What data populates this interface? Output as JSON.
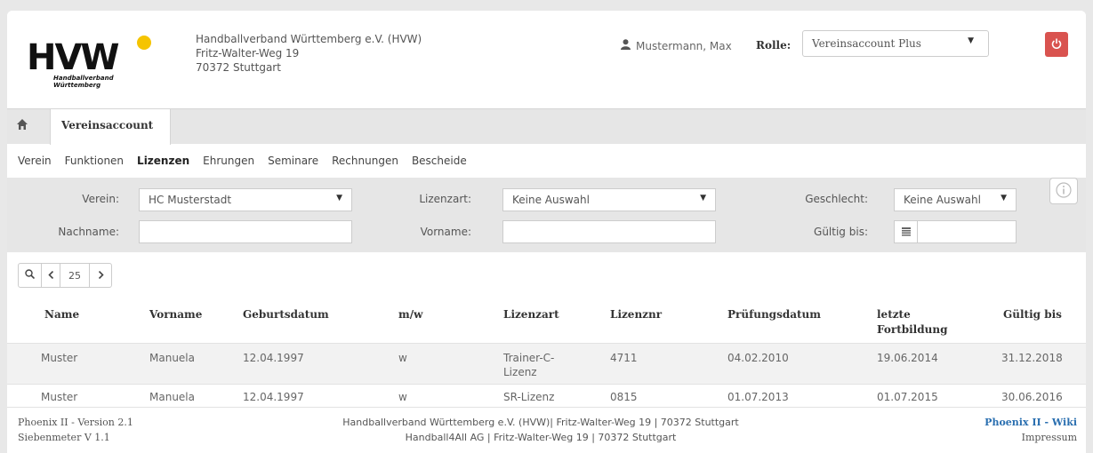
{
  "header": {
    "logo_text": "HVW",
    "logo_sub": "Handballverband Württemberg",
    "org_lines": [
      "Handballverband Württemberg e.V. (HVW)",
      "Fritz-Walter-Weg 19",
      "70372 Stuttgart"
    ],
    "user": "Mustermann, Max",
    "role_label": "Rolle:",
    "role_value": "Vereinsaccount Plus"
  },
  "tabs": {
    "active": "Vereinsaccount"
  },
  "subnav": [
    "Verein",
    "Funktionen",
    "Lizenzen",
    "Ehrungen",
    "Seminare",
    "Rechnungen",
    "Bescheide"
  ],
  "subnav_active": "Lizenzen",
  "filter": {
    "verein_label": "Verein:",
    "verein_value": "HC Musterstadt",
    "lizenzart_label": "Lizenzart:",
    "lizenzart_value": "Keine Auswahl",
    "geschlecht_label": "Geschlecht:",
    "geschlecht_value": "Keine Auswahl",
    "nachname_label": "Nachname:",
    "nachname_value": "",
    "vorname_label": "Vorname:",
    "vorname_value": "",
    "gueltig_label": "Gültig bis:",
    "gueltig_value": ""
  },
  "pager": {
    "page_size": "25"
  },
  "table": {
    "headers": [
      "Name",
      "Vorname",
      "Geburtsdatum",
      "m/w",
      "Lizenzart",
      "Lizenznr",
      "Prüfungsdatum",
      "letzte Fortbildung",
      "Gültig bis"
    ],
    "rows": [
      [
        "Muster",
        "Manuela",
        "12.04.1997",
        "w",
        "Trainer-C-Lizenz",
        "4711",
        "04.02.2010",
        "19.06.2014",
        "31.12.2018"
      ],
      [
        "Muster",
        "Manuela",
        "12.04.1997",
        "w",
        "SR-Lizenz",
        "0815",
        "01.07.2013",
        "01.07.2015",
        "30.06.2016"
      ]
    ]
  },
  "footer": {
    "version": "Phoenix II - Version 2.1",
    "siebenmeter": "Siebenmeter V 1.1",
    "line1": "Handballverband Württemberg e.V. (HVW)| Fritz-Walter-Weg 19 | 70372 Stuttgart",
    "line2": "Handball4All AG | Fritz-Walter-Weg 19 | 70372 Stuttgart",
    "wiki": "Phoenix II - Wiki",
    "impressum": "Impressum"
  },
  "colors": {
    "logout": "#d9534f",
    "wiki": "#2a6fb0",
    "panel": "#e6e6e6"
  },
  "icons": [
    "user-icon",
    "power-icon",
    "home-icon",
    "info-icon",
    "search-icon",
    "chevron-left-icon",
    "chevron-right-icon",
    "calendar-icon"
  ]
}
